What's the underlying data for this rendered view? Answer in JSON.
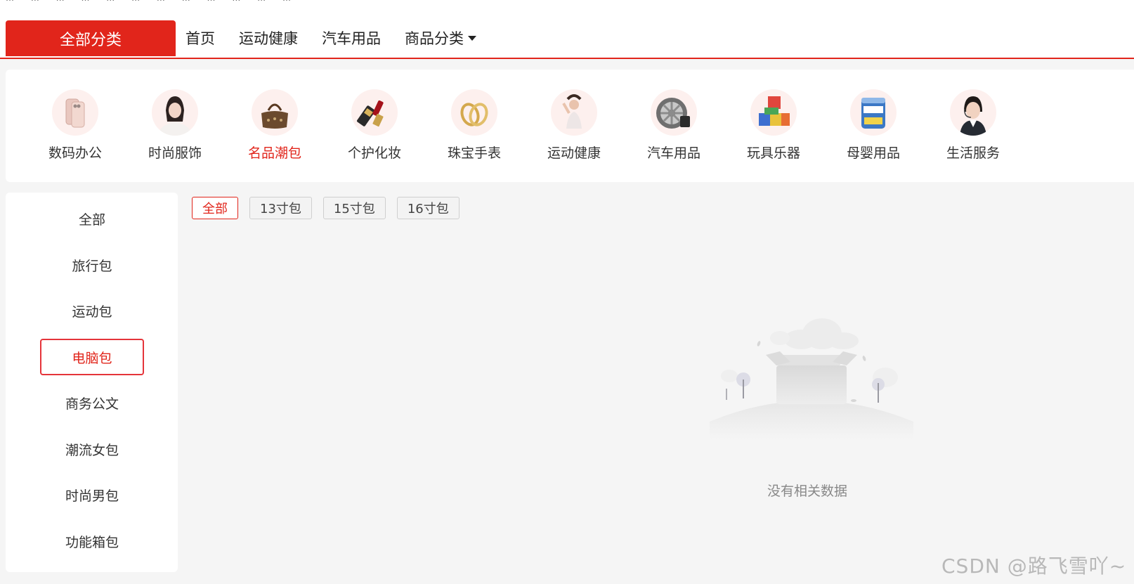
{
  "top_strip": {
    "text": "… … … … … … … … … … … …"
  },
  "navbar": {
    "all_categories": "全部分类",
    "links": [
      "首页",
      "运动健康",
      "汽车用品",
      "商品分类"
    ]
  },
  "categories": [
    {
      "label": "数码办公",
      "icon": "phone-icon"
    },
    {
      "label": "时尚服饰",
      "icon": "fashion-model-icon"
    },
    {
      "label": "名品潮包",
      "icon": "handbag-icon"
    },
    {
      "label": "个护化妆",
      "icon": "lipstick-icon"
    },
    {
      "label": "珠宝手表",
      "icon": "rings-icon"
    },
    {
      "label": "运动健康",
      "icon": "yoga-icon"
    },
    {
      "label": "汽车用品",
      "icon": "wheel-icon"
    },
    {
      "label": "玩具乐器",
      "icon": "toy-blocks-icon"
    },
    {
      "label": "母婴用品",
      "icon": "formula-can-icon"
    },
    {
      "label": "生活服务",
      "icon": "service-agent-icon"
    }
  ],
  "active_category": "名品潮包",
  "sidebar": {
    "items": [
      "全部",
      "旅行包",
      "运动包",
      "电脑包",
      "商务公文",
      "潮流女包",
      "时尚男包",
      "功能箱包"
    ],
    "active": "电脑包"
  },
  "filters": {
    "items": [
      "全部",
      "13寸包",
      "15寸包",
      "16寸包"
    ],
    "active": "全部"
  },
  "empty_state": {
    "text": "没有相关数据"
  },
  "watermark": "CSDN @路飞雪吖~",
  "colors": {
    "accent": "#e1251b",
    "background": "#f5f5f5"
  }
}
